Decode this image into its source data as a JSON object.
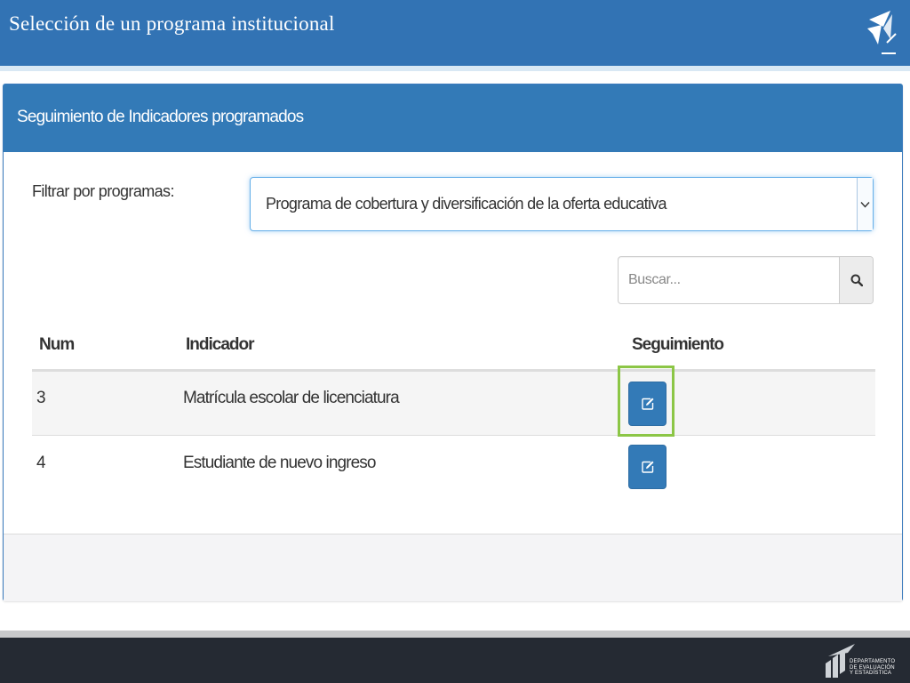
{
  "slide": {
    "title": "Selección de un programa institucional",
    "footer_lines": [
      "DEPARTAMENTO",
      "DE EVALUACIÓN",
      "Y ESTADÍSTICA"
    ]
  },
  "panel": {
    "title": "Seguimiento de Indicadores programados",
    "filter_label": "Filtrar por programas:",
    "program_select": {
      "selected": "Programa de cobertura y diversificación de la oferta educativa",
      "icon": "chevron-down-icon"
    },
    "search": {
      "placeholder": "Buscar...",
      "icon": "search-icon"
    },
    "table": {
      "headers": [
        "Num",
        "Indicador",
        "Seguimiento"
      ],
      "rows": [
        {
          "num": "3",
          "indicador": "Matrícula escolar de licenciatura",
          "action_icon": "edit-icon"
        },
        {
          "num": "4",
          "indicador": "Estudiante de nuevo ingreso",
          "action_icon": "edit-icon"
        }
      ]
    }
  },
  "colors": {
    "header_blue": "#3273b4",
    "panel_blue": "#337ab7",
    "highlight_green": "#8cc646",
    "footer_dark": "#252a33"
  }
}
